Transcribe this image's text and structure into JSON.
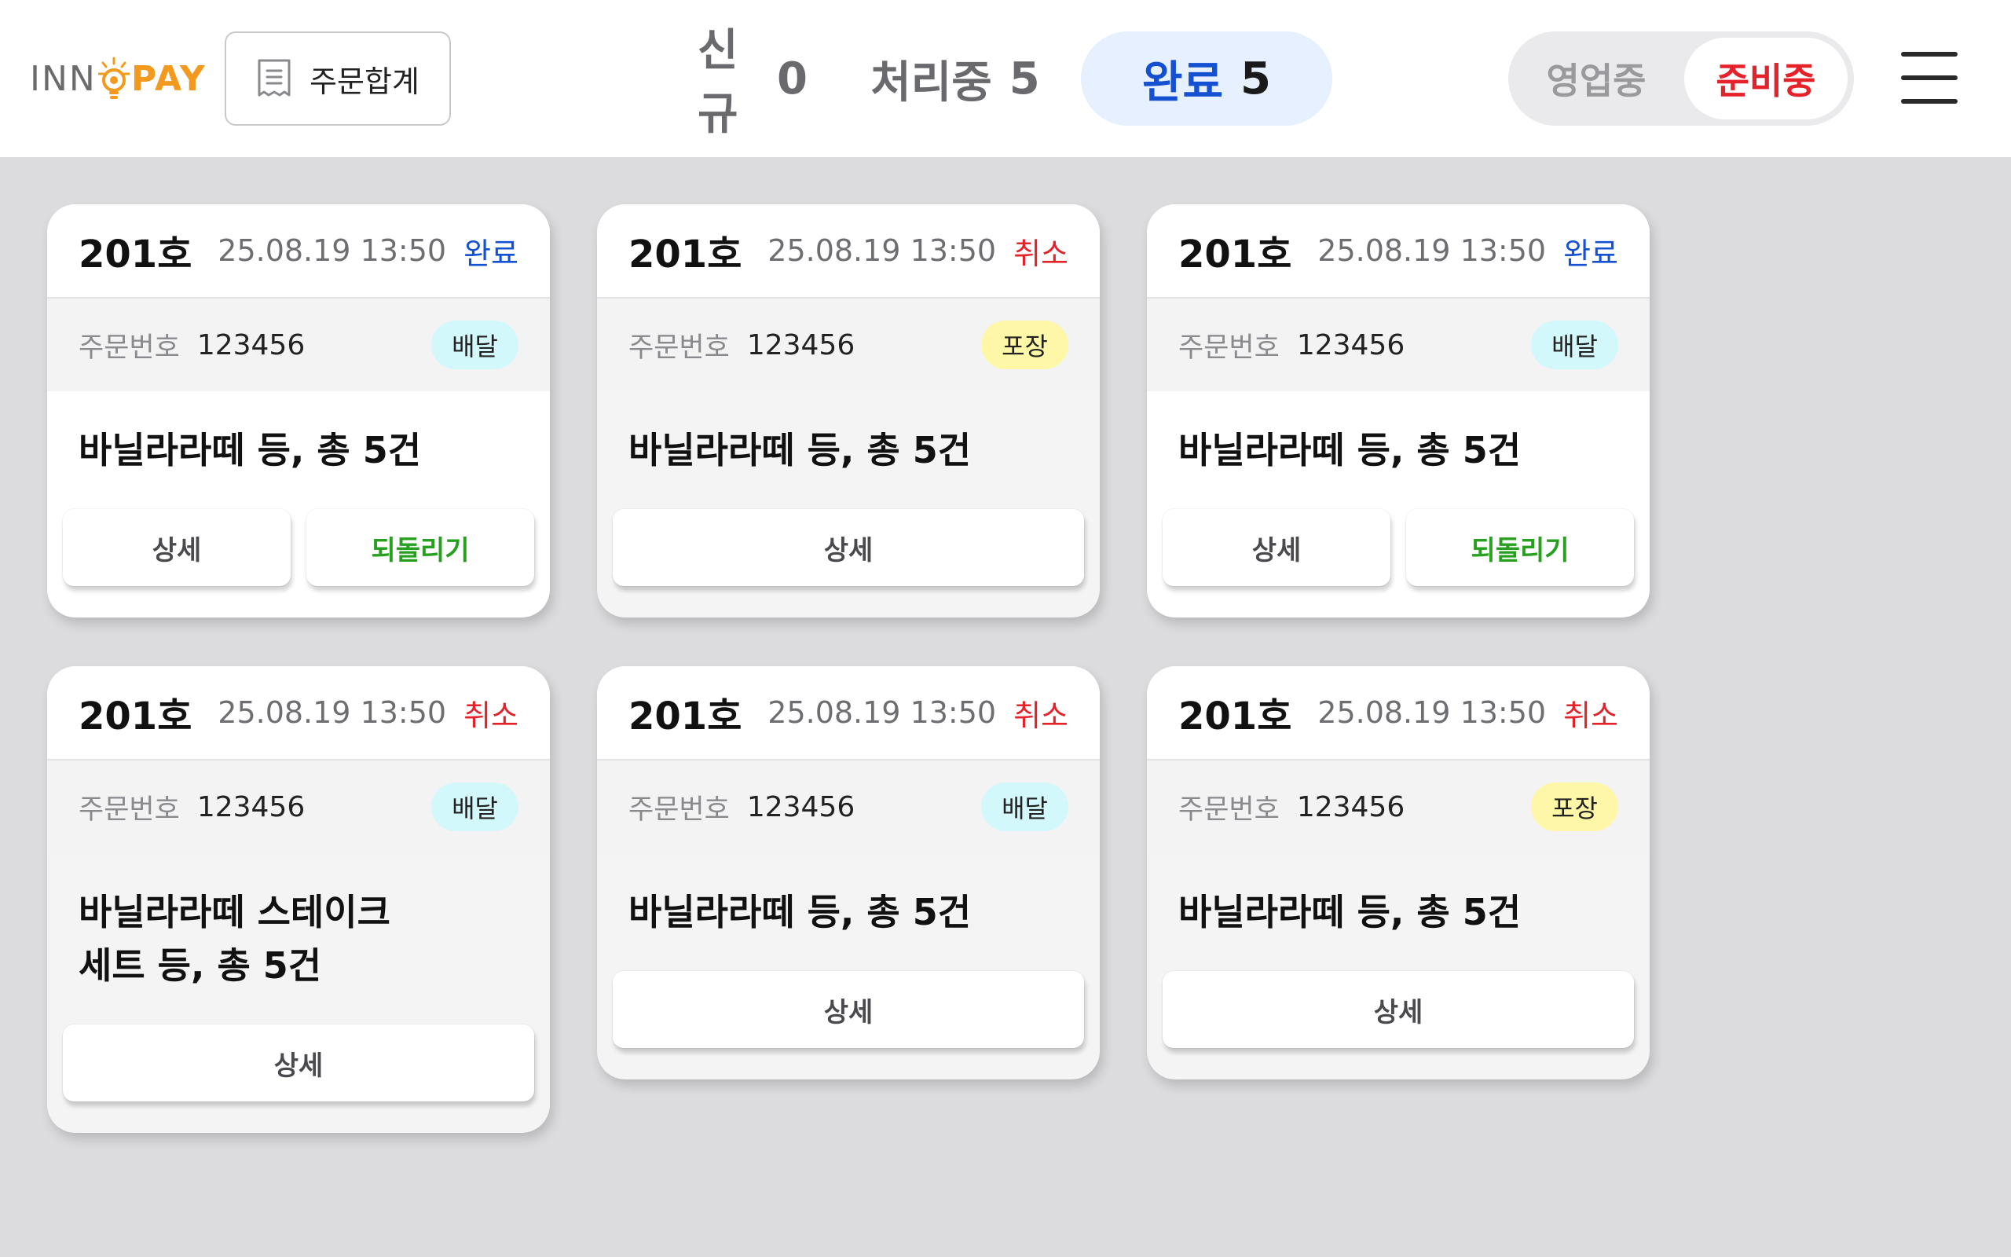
{
  "header": {
    "logo": {
      "part1": "INN",
      "part2": "PAY"
    },
    "summary_button": {
      "label": "주문합계",
      "icon": "receipt-icon"
    },
    "tabs": [
      {
        "label": "신규",
        "count": "0"
      },
      {
        "label": "처리중",
        "count": "5"
      },
      {
        "label": "완료",
        "count": "5",
        "active": true
      }
    ],
    "toggle": {
      "open_label": "영업중",
      "prep_label": "준비중",
      "active": "준비중"
    },
    "menu_icon": "hamburger-menu-icon"
  },
  "colors": {
    "status_done": "#1450d2",
    "status_cancel": "#e5222a",
    "badge_delivery": "#d3f8fb",
    "badge_pack": "#fff7a8",
    "revert_green": "#27a020",
    "logo_orange": "#f39a1e"
  },
  "order_number_label": "주문번호",
  "cards": [
    {
      "room": "201호",
      "time": "25.08.19 13:50",
      "status": "완료",
      "order_no": "123456",
      "type": "배달",
      "summary": "바닐라라떼 등, 총 5건",
      "detail_label": "상세",
      "revert_label": "되돌리기"
    },
    {
      "room": "201호",
      "time": "25.08.19 13:50",
      "status": "취소",
      "order_no": "123456",
      "type": "포장",
      "summary": "바닐라라떼 등, 총 5건",
      "detail_label": "상세"
    },
    {
      "room": "201호",
      "time": "25.08.19 13:50",
      "status": "완료",
      "order_no": "123456",
      "type": "배달",
      "summary": "바닐라라떼 등, 총 5건",
      "detail_label": "상세",
      "revert_label": "되돌리기"
    },
    {
      "room": "201호",
      "time": "25.08.19 13:50",
      "status": "취소",
      "order_no": "123456",
      "type": "배달",
      "summary_line1": "바닐라라떼 스테이크",
      "summary_line2": "세트 등, 총 5건",
      "detail_label": "상세"
    },
    {
      "room": "201호",
      "time": "25.08.19 13:50",
      "status": "취소",
      "order_no": "123456",
      "type": "배달",
      "summary": "바닐라라떼 등, 총 5건",
      "detail_label": "상세"
    },
    {
      "room": "201호",
      "time": "25.08.19 13:50",
      "status": "취소",
      "order_no": "123456",
      "type": "포장",
      "summary": "바닐라라떼 등, 총 5건",
      "detail_label": "상세"
    }
  ]
}
